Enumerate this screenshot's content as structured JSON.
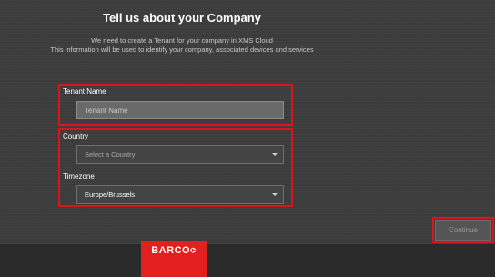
{
  "header": {
    "title": "Tell us about your Company",
    "subtitle_line1": "We need to create a Tenant for your company in XMS Cloud",
    "subtitle_line2": "This information will be used to identify your company, associated devices and services"
  },
  "form": {
    "tenant_name": {
      "label": "Tenant Name",
      "placeholder": "Tenant Name",
      "value": ""
    },
    "country": {
      "label": "Country",
      "selected": "Select a Country"
    },
    "timezone": {
      "label": "Timezone",
      "selected": "Europe/Brussels"
    }
  },
  "actions": {
    "continue_label": "Continue"
  },
  "footer": {
    "logo_text": "BARCO",
    "logo_mark": "⌬"
  },
  "colors": {
    "highlight": "#d9141b",
    "brand_red": "#e3201f",
    "background": "#3c3c3c"
  }
}
